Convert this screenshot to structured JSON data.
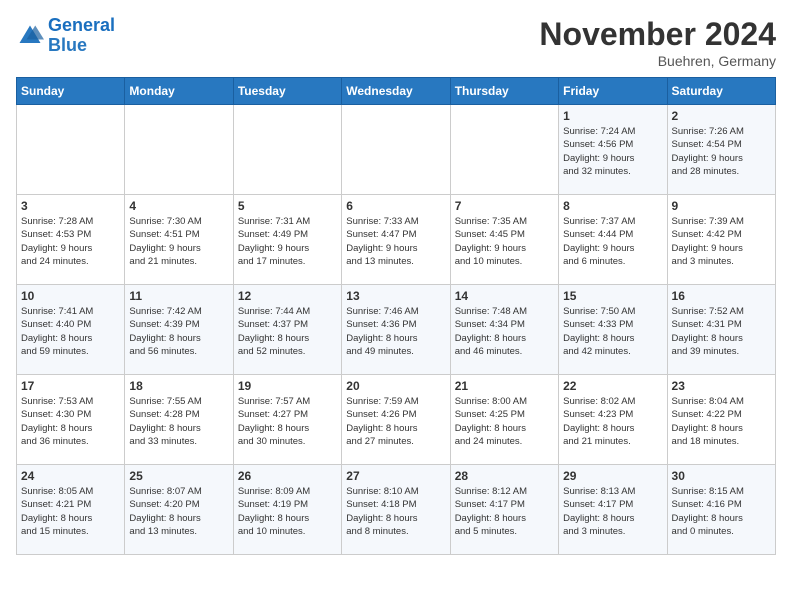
{
  "header": {
    "logo_line1": "General",
    "logo_line2": "Blue",
    "month": "November 2024",
    "location": "Buehren, Germany"
  },
  "weekdays": [
    "Sunday",
    "Monday",
    "Tuesday",
    "Wednesday",
    "Thursday",
    "Friday",
    "Saturday"
  ],
  "weeks": [
    [
      {
        "day": "",
        "info": ""
      },
      {
        "day": "",
        "info": ""
      },
      {
        "day": "",
        "info": ""
      },
      {
        "day": "",
        "info": ""
      },
      {
        "day": "",
        "info": ""
      },
      {
        "day": "1",
        "info": "Sunrise: 7:24 AM\nSunset: 4:56 PM\nDaylight: 9 hours\nand 32 minutes."
      },
      {
        "day": "2",
        "info": "Sunrise: 7:26 AM\nSunset: 4:54 PM\nDaylight: 9 hours\nand 28 minutes."
      }
    ],
    [
      {
        "day": "3",
        "info": "Sunrise: 7:28 AM\nSunset: 4:53 PM\nDaylight: 9 hours\nand 24 minutes."
      },
      {
        "day": "4",
        "info": "Sunrise: 7:30 AM\nSunset: 4:51 PM\nDaylight: 9 hours\nand 21 minutes."
      },
      {
        "day": "5",
        "info": "Sunrise: 7:31 AM\nSunset: 4:49 PM\nDaylight: 9 hours\nand 17 minutes."
      },
      {
        "day": "6",
        "info": "Sunrise: 7:33 AM\nSunset: 4:47 PM\nDaylight: 9 hours\nand 13 minutes."
      },
      {
        "day": "7",
        "info": "Sunrise: 7:35 AM\nSunset: 4:45 PM\nDaylight: 9 hours\nand 10 minutes."
      },
      {
        "day": "8",
        "info": "Sunrise: 7:37 AM\nSunset: 4:44 PM\nDaylight: 9 hours\nand 6 minutes."
      },
      {
        "day": "9",
        "info": "Sunrise: 7:39 AM\nSunset: 4:42 PM\nDaylight: 9 hours\nand 3 minutes."
      }
    ],
    [
      {
        "day": "10",
        "info": "Sunrise: 7:41 AM\nSunset: 4:40 PM\nDaylight: 8 hours\nand 59 minutes."
      },
      {
        "day": "11",
        "info": "Sunrise: 7:42 AM\nSunset: 4:39 PM\nDaylight: 8 hours\nand 56 minutes."
      },
      {
        "day": "12",
        "info": "Sunrise: 7:44 AM\nSunset: 4:37 PM\nDaylight: 8 hours\nand 52 minutes."
      },
      {
        "day": "13",
        "info": "Sunrise: 7:46 AM\nSunset: 4:36 PM\nDaylight: 8 hours\nand 49 minutes."
      },
      {
        "day": "14",
        "info": "Sunrise: 7:48 AM\nSunset: 4:34 PM\nDaylight: 8 hours\nand 46 minutes."
      },
      {
        "day": "15",
        "info": "Sunrise: 7:50 AM\nSunset: 4:33 PM\nDaylight: 8 hours\nand 42 minutes."
      },
      {
        "day": "16",
        "info": "Sunrise: 7:52 AM\nSunset: 4:31 PM\nDaylight: 8 hours\nand 39 minutes."
      }
    ],
    [
      {
        "day": "17",
        "info": "Sunrise: 7:53 AM\nSunset: 4:30 PM\nDaylight: 8 hours\nand 36 minutes."
      },
      {
        "day": "18",
        "info": "Sunrise: 7:55 AM\nSunset: 4:28 PM\nDaylight: 8 hours\nand 33 minutes."
      },
      {
        "day": "19",
        "info": "Sunrise: 7:57 AM\nSunset: 4:27 PM\nDaylight: 8 hours\nand 30 minutes."
      },
      {
        "day": "20",
        "info": "Sunrise: 7:59 AM\nSunset: 4:26 PM\nDaylight: 8 hours\nand 27 minutes."
      },
      {
        "day": "21",
        "info": "Sunrise: 8:00 AM\nSunset: 4:25 PM\nDaylight: 8 hours\nand 24 minutes."
      },
      {
        "day": "22",
        "info": "Sunrise: 8:02 AM\nSunset: 4:23 PM\nDaylight: 8 hours\nand 21 minutes."
      },
      {
        "day": "23",
        "info": "Sunrise: 8:04 AM\nSunset: 4:22 PM\nDaylight: 8 hours\nand 18 minutes."
      }
    ],
    [
      {
        "day": "24",
        "info": "Sunrise: 8:05 AM\nSunset: 4:21 PM\nDaylight: 8 hours\nand 15 minutes."
      },
      {
        "day": "25",
        "info": "Sunrise: 8:07 AM\nSunset: 4:20 PM\nDaylight: 8 hours\nand 13 minutes."
      },
      {
        "day": "26",
        "info": "Sunrise: 8:09 AM\nSunset: 4:19 PM\nDaylight: 8 hours\nand 10 minutes."
      },
      {
        "day": "27",
        "info": "Sunrise: 8:10 AM\nSunset: 4:18 PM\nDaylight: 8 hours\nand 8 minutes."
      },
      {
        "day": "28",
        "info": "Sunrise: 8:12 AM\nSunset: 4:17 PM\nDaylight: 8 hours\nand 5 minutes."
      },
      {
        "day": "29",
        "info": "Sunrise: 8:13 AM\nSunset: 4:17 PM\nDaylight: 8 hours\nand 3 minutes."
      },
      {
        "day": "30",
        "info": "Sunrise: 8:15 AM\nSunset: 4:16 PM\nDaylight: 8 hours\nand 0 minutes."
      }
    ]
  ]
}
